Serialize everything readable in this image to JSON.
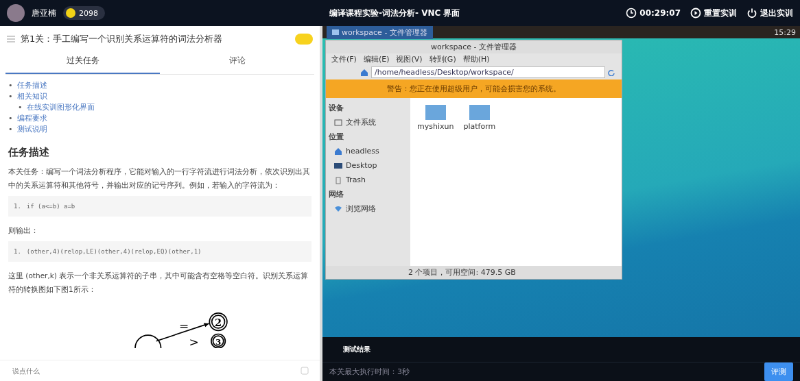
{
  "top_bar": {
    "user_name": "唐亚楠",
    "coins": "2098",
    "title": "编译课程实验-词法分析- VNC 界面",
    "timer": "00:29:07",
    "actions": [
      {
        "kind": "reset",
        "label": "重置实训"
      },
      {
        "kind": "exit",
        "label": "退出实训"
      }
    ]
  },
  "task": {
    "title": "第1关：手工编写一个识别关系运算符的词法分析器",
    "tabs": [
      {
        "label": "过关任务",
        "selected": true
      },
      {
        "label": "评论",
        "selected": false
      }
    ],
    "toc": [
      {
        "bullet": "•",
        "label": "任务描述"
      },
      {
        "bullet": "•",
        "label": "相关知识",
        "children": [
          {
            "bullet": "•",
            "label": "在线实训图形化界面"
          }
        ]
      },
      {
        "bullet": "•",
        "label": "编程要求"
      },
      {
        "bullet": "•",
        "label": "测试说明"
      }
    ],
    "content": [
      {
        "kind": "heading",
        "text": "任务描述"
      },
      {
        "kind": "paragraph",
        "text": "本关任务：编写一个词法分析程序，它能对输入的一行字符流进行词法分析，依次识别出其中的关系运算符和其他符号，并输出对应的记号序列。例如，若输入的字符流为："
      },
      {
        "kind": "code",
        "number": "1.",
        "text": "if (a<=b) a=b"
      },
      {
        "kind": "paragraph",
        "text": "则输出："
      },
      {
        "kind": "code",
        "number": "1.",
        "text": "(other,4)(relop,LE)(other,4)(relop,EQ)(other,1)"
      },
      {
        "kind": "paragraph",
        "text": "这里 (other,k) 表示一个非关系运算符的子串，其中可能含有空格等空白符。识别关系运算符的转换图如下图1所示："
      },
      {
        "kind": "diagram",
        "labels": [
          "=",
          ">"
        ],
        "states": [
          "2",
          "3"
        ]
      }
    ],
    "comment_placeholder": "说点什么"
  },
  "vnc": {
    "taskbar": {
      "window_button": "workspace - 文件管理器",
      "clock": "15:29"
    },
    "file_manager": {
      "title": "workspace - 文件管理器",
      "menu": [
        "文件(F)",
        "编辑(E)",
        "视图(V)",
        "转到(G)",
        "帮助(H)"
      ],
      "path": "/home/headless/Desktop/workspace/",
      "warning": "警告：您正在使用超级用户，可能会损害您的系统。",
      "sidebar": [
        {
          "kind": "header",
          "label": "设备"
        },
        {
          "kind": "drive",
          "label": "文件系统"
        },
        {
          "kind": "header",
          "label": "位置"
        },
        {
          "kind": "home",
          "label": "headless"
        },
        {
          "kind": "desktop",
          "label": "Desktop"
        },
        {
          "kind": "trash",
          "label": "Trash"
        },
        {
          "kind": "header",
          "label": "网络"
        },
        {
          "kind": "network",
          "label": "浏览网络"
        }
      ],
      "folders": [
        "myshixun",
        "platform"
      ],
      "status": "2 个项目，可用空间: 479.5 GB"
    }
  },
  "result_panel": {
    "tab": "测试结果",
    "message": "本关最大执行时间：3秒",
    "evaluate_button": "评测"
  }
}
